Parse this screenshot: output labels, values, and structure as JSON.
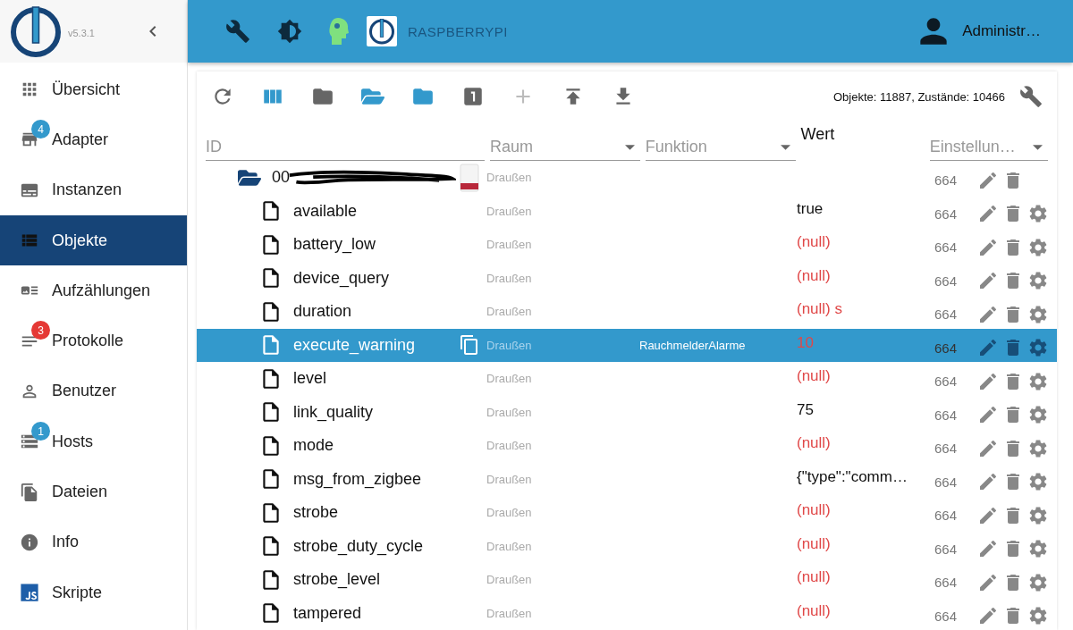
{
  "sidebar": {
    "version": "v5.3.1",
    "items": [
      {
        "label": "Übersicht",
        "selected": false
      },
      {
        "label": "Adapter",
        "selected": false,
        "badge": "4",
        "color": "#3399cc"
      },
      {
        "label": "Instanzen",
        "selected": false
      },
      {
        "label": "Objekte",
        "selected": true
      },
      {
        "label": "Aufzählungen",
        "selected": false
      },
      {
        "label": "Protokolle",
        "selected": false,
        "badge": "3",
        "color": "#e53935"
      },
      {
        "label": "Benutzer",
        "selected": false
      },
      {
        "label": "Hosts",
        "selected": false,
        "badge": "1",
        "color": "#3399cc"
      },
      {
        "label": "Dateien",
        "selected": false
      },
      {
        "label": "Info",
        "selected": false
      },
      {
        "label": "Skripte",
        "selected": false
      }
    ]
  },
  "topbar": {
    "host": "RASPBERRYPI",
    "user": "Administr…"
  },
  "toolbar": {
    "stats": "Objekte: 11887, Zustände: 10466"
  },
  "filters": {
    "id_placeholder": "ID",
    "room": "Raum",
    "function": "Funktion",
    "value": "Wert",
    "settings": "Einstellun…"
  },
  "rows": [
    {
      "kind": "folder",
      "name": "00",
      "room": "Draußen",
      "perms": "664",
      "selected": false
    },
    {
      "kind": "state",
      "name": "available",
      "room": "Draußen",
      "value": "true",
      "invalid": false,
      "perms": "664",
      "selected": false
    },
    {
      "kind": "state",
      "name": "battery_low",
      "room": "Draußen",
      "value": "(null)",
      "invalid": true,
      "perms": "664",
      "selected": false
    },
    {
      "kind": "state",
      "name": "device_query",
      "room": "Draußen",
      "value": "(null)",
      "invalid": true,
      "perms": "664",
      "selected": false
    },
    {
      "kind": "state",
      "name": "duration",
      "room": "Draußen",
      "value": "(null) s",
      "invalid": true,
      "perms": "664",
      "selected": false
    },
    {
      "kind": "state",
      "name": "execute_warning",
      "room": "Draußen",
      "function": "RauchmelderAlarme",
      "value": "10",
      "invalid": true,
      "perms": "664",
      "selected": true
    },
    {
      "kind": "state",
      "name": "level",
      "room": "Draußen",
      "value": "(null)",
      "invalid": true,
      "perms": "664",
      "selected": false
    },
    {
      "kind": "state",
      "name": "link_quality",
      "room": "Draußen",
      "value": "75",
      "invalid": false,
      "perms": "664",
      "selected": false
    },
    {
      "kind": "state",
      "name": "mode",
      "room": "Draußen",
      "value": "(null)",
      "invalid": true,
      "perms": "664",
      "selected": false
    },
    {
      "kind": "state",
      "name": "msg_from_zigbee",
      "room": "Draußen",
      "value": "{\"type\":\"comm…",
      "invalid": false,
      "perms": "664",
      "selected": false
    },
    {
      "kind": "state",
      "name": "strobe",
      "room": "Draußen",
      "value": "(null)",
      "invalid": true,
      "perms": "664",
      "selected": false
    },
    {
      "kind": "state",
      "name": "strobe_duty_cycle",
      "room": "Draußen",
      "value": "(null)",
      "invalid": true,
      "perms": "664",
      "selected": false
    },
    {
      "kind": "state",
      "name": "strobe_level",
      "room": "Draußen",
      "value": "(null)",
      "invalid": true,
      "perms": "664",
      "selected": false
    },
    {
      "kind": "state",
      "name": "tampered",
      "room": "Draußen",
      "value": "(null)",
      "invalid": true,
      "perms": "664",
      "selected": false
    }
  ]
}
